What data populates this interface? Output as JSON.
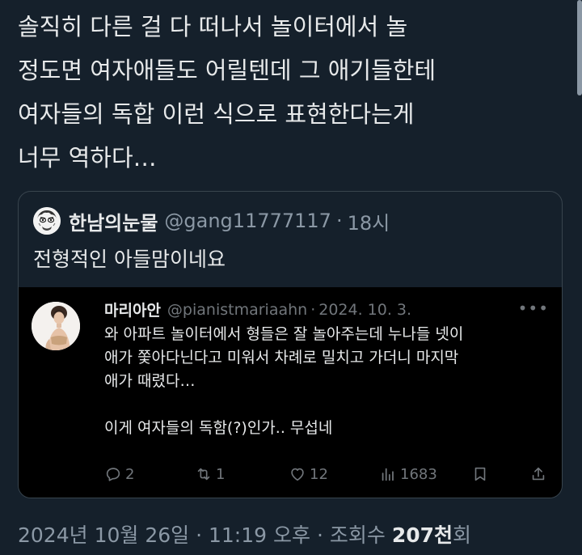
{
  "tweet": {
    "lines": [
      "솔직히 다른 걸 다 떠나서 놀이터에서 놀",
      "정도면 여자애들도 어릴텐데 그 애기들한테",
      "여자들의 독합 이런 식으로 표현한다는게",
      "너무 역하다…"
    ]
  },
  "quote": {
    "avatar_icon": "meme-face-avatar-icon",
    "name": "한남의눈물",
    "handle": "@gang11777117",
    "dot": "·",
    "time": "18시",
    "body": "전형적인 아들맘이네요",
    "embed": {
      "avatar_icon": "profile-photo-avatar",
      "name": "마리아안",
      "handle": "@pianistmariaahn",
      "dot": "·",
      "time": "2024. 10. 3.",
      "more_icon": "more-options-icon",
      "lines": [
        "와 아파트 놀이터에서 형들은 잘 놀아주는데 누나들 넷이",
        "애가 쫓아다닌다고 미워서 차례로 밀치고 가더니 마지막",
        "애가 때렸다…",
        "",
        "이게 여자들의 독함(?)인가.. 무섭네"
      ],
      "actions": {
        "reply": {
          "icon": "reply-icon",
          "count": "2"
        },
        "retweet": {
          "icon": "retweet-icon",
          "count": "1"
        },
        "like": {
          "icon": "heart-icon",
          "count": "12"
        },
        "views": {
          "icon": "views-chart-icon",
          "count": "1683"
        },
        "bookmark": {
          "icon": "bookmark-icon"
        },
        "share": {
          "icon": "share-icon"
        }
      }
    }
  },
  "meta": {
    "date": "2024년 10월 26일",
    "sep1": "·",
    "time": "11:19 오후",
    "sep2": "·",
    "views_label": "조회수",
    "views_count": "207천",
    "views_suffix": "회"
  }
}
